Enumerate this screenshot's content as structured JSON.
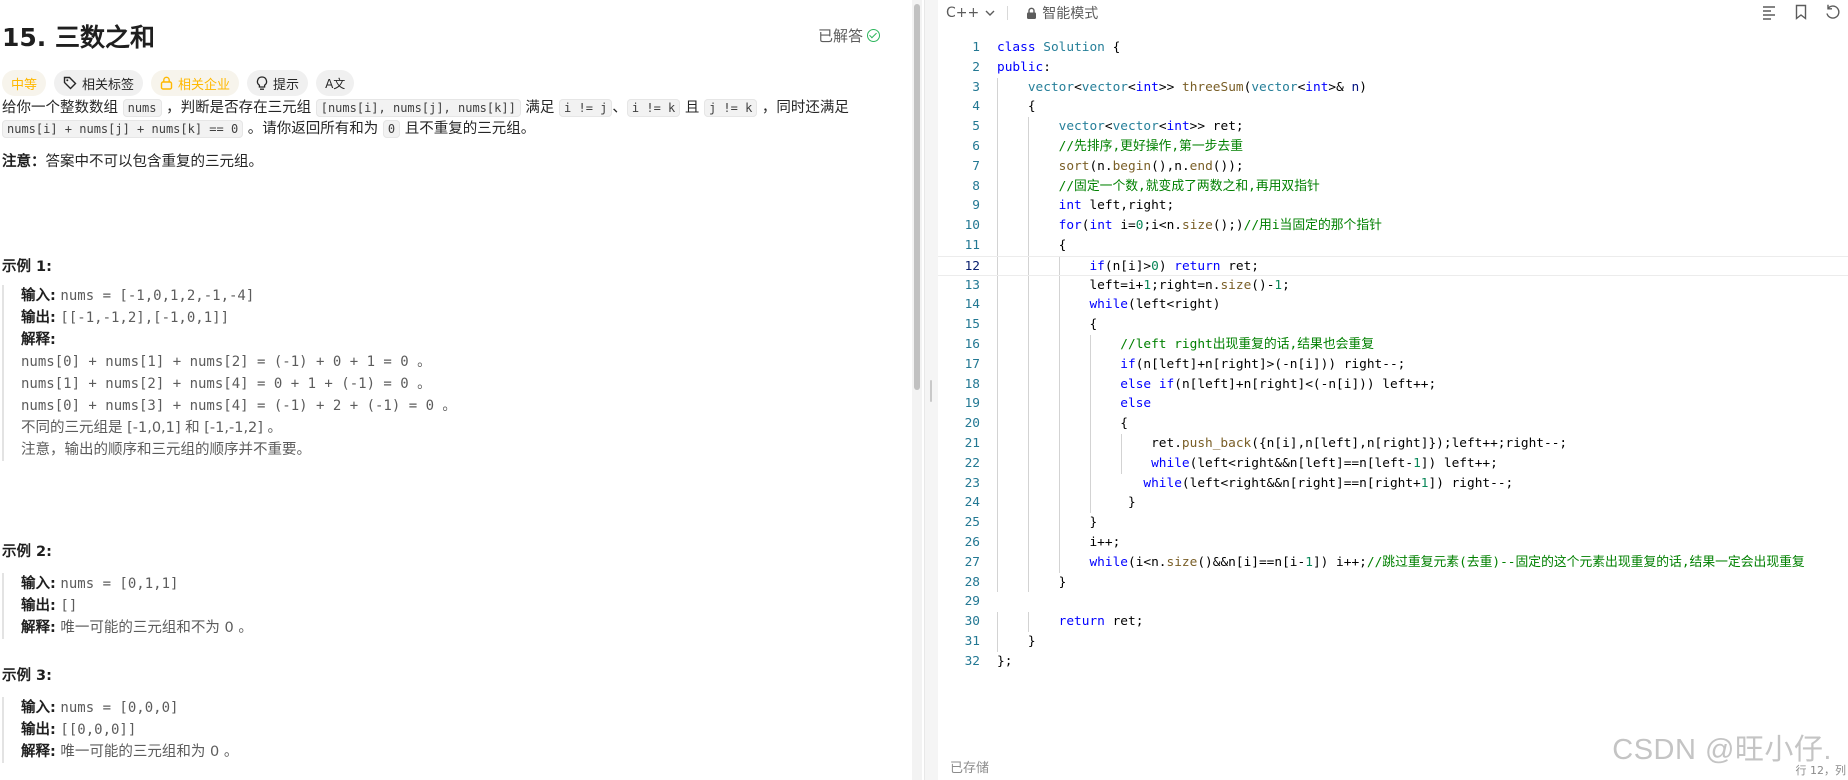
{
  "problem": {
    "title": "15. 三数之和",
    "solved_label": "已解答",
    "tags": {
      "difficulty": "中等",
      "related_tags": "相关标签",
      "related_companies": "相关企业",
      "hint": "提示",
      "translate": "A文"
    },
    "desc": {
      "p1_a": "给你一个整数数组 ",
      "p1_nums": "nums",
      "p1_b": " ，判断是否存在三元组 ",
      "p1_triple": "[nums[i], nums[j], nums[k]]",
      "p1_c": " 满足 ",
      "p1_ij": "i != j",
      "p1_d": "、",
      "p1_ik": "i != k",
      "p1_e": " 且 ",
      "p1_jk": "j != k",
      "p1_f": " ，同时还满足",
      "p2_sum": "nums[i] + nums[j] + nums[k] == 0",
      "p2_a": " 。请你返回所有和为 ",
      "p2_zero": "0",
      "p2_b": " 且不重复的三元组。",
      "note_label": "注意：",
      "note_text": "答案中不可以包含重复的三元组。"
    },
    "examples": [
      {
        "title": "示例 1:",
        "input_label": "输入:",
        "input": "nums = [-1,0,1,2,-1,-4]",
        "output_label": "输出:",
        "output": "[[-1,-1,2],[-1,0,1]]",
        "explain_label": "解释:",
        "explain_lines": [
          "nums[0] + nums[1] + nums[2] = (-1) + 0 + 1 = 0 。",
          "nums[1] + nums[2] + nums[4] = 0 + 1 + (-1) = 0 。",
          "nums[0] + nums[3] + nums[4] = (-1) + 2 + (-1) = 0 。",
          "不同的三元组是 [-1,0,1] 和 [-1,-1,2] 。",
          "注意，输出的顺序和三元组的顺序并不重要。"
        ]
      },
      {
        "title": "示例 2:",
        "input_label": "输入:",
        "input": "nums = [0,1,1]",
        "output_label": "输出:",
        "output": "[]",
        "explain_label": "解释:",
        "explain": "唯一可能的三元组和不为 0 。"
      },
      {
        "title": "示例 3:",
        "input_label": "输入:",
        "input": "nums = [0,0,0]",
        "output_label": "输出:",
        "output": "[[0,0,0]]",
        "explain_label": "解释:",
        "explain": "唯一可能的三元组和为 0 。"
      }
    ]
  },
  "editor": {
    "language": "C++",
    "mode": "智能模式",
    "status": "已存储",
    "cursor": "行 12，列",
    "watermark": "CSDN @旺小仔.",
    "current_line": 12,
    "lines": [
      "class Solution {",
      "public:",
      "    vector<vector<int>> threeSum(vector<int>& n)",
      "    {",
      "        vector<vector<int>> ret;",
      "        //先排序,更好操作,第一步去重",
      "        sort(n.begin(),n.end());",
      "        //固定一个数,就变成了两数之和,再用双指针",
      "        int left,right;",
      "        for(int i=0;i<n.size();)//用i当固定的那个指针",
      "        {",
      "            if(n[i]>0) return ret;",
      "            left=i+1;right=n.size()-1;",
      "            while(left<right)",
      "            {",
      "                //left right出现重复的话,结果也会重复",
      "                if(n[left]+n[right]>(-n[i])) right--;",
      "                else if(n[left]+n[right]<(-n[i])) left++;",
      "                else",
      "                {",
      "                    ret.push_back({n[i],n[left],n[right]});left++;right--;",
      "                    while(left<right&&n[left]==n[left-1]) left++;",
      "                   while(left<right&&n[right]==n[right+1]) right--;",
      "                 }",
      "            }",
      "            i++;",
      "            while(i<n.size()&&n[i]==n[i-1]) i++;//跳过重复元素(去重)--固定的这个元素出现重复的话,结果一定会出现重复",
      "        }",
      "",
      "        return ret;",
      "    }",
      "};"
    ]
  }
}
